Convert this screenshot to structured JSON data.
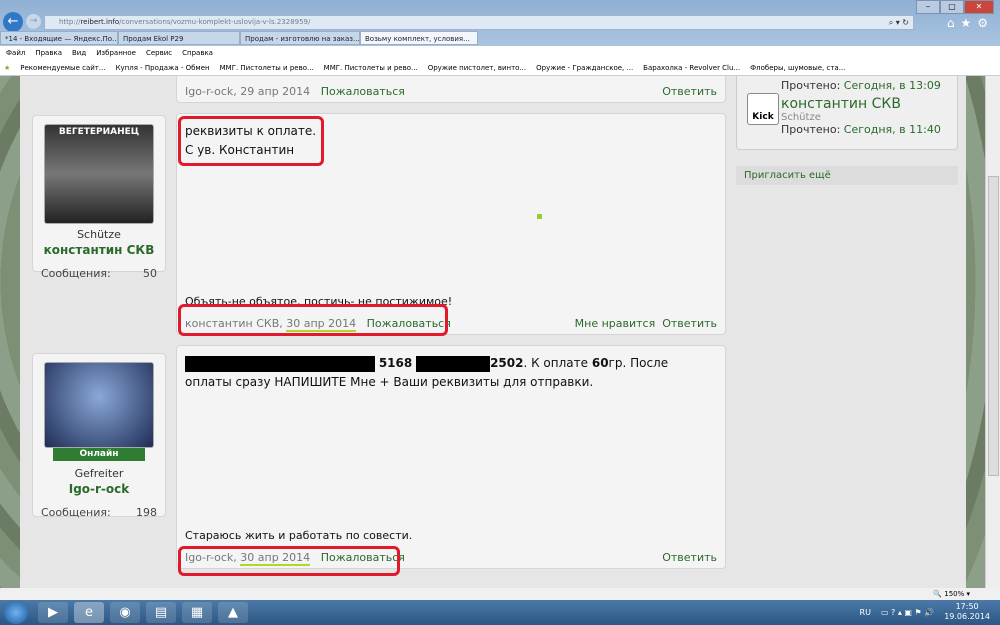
{
  "browser": {
    "url_prefix": "http://",
    "url_host": "reibert.info",
    "url_path": "/conversations/vozmu-komplekt-uslovija-v-ls.2328959/",
    "tabs": [
      {
        "label": "*14 - Входящие — Яндекс.По..."
      },
      {
        "label": "Продам Ekol P29"
      },
      {
        "label": "Продам - изготовлю на заказ..."
      },
      {
        "label": "Возьму комплект, условия..."
      }
    ],
    "menu": [
      "Файл",
      "Правка",
      "Вид",
      "Избранное",
      "Сервис",
      "Справка"
    ],
    "favorites": [
      "Рекомендуемые сайт...",
      "Купля - Продажа - Обмен",
      "ММГ. Пистолеты и рево...",
      "ММГ. Пистолеты и рево...",
      "Оружие пистолет, винто...",
      "Оружие - Гражданское, ...",
      "Барахолка - Revolver Clu...",
      "Флоберы, шумовые, ста..."
    ],
    "zoom": "150%"
  },
  "posts": [
    {
      "author": "Igo-r-ock",
      "date": "29 апр 2014",
      "report": "Пожаловаться",
      "reply": "Ответить"
    },
    {
      "user_title": "Schütze",
      "username": "константин СКВ",
      "stats_label": "Сообщения:",
      "stats_value": "50",
      "avatar_text": "ВЕГЕТЕРИАНЕЦ",
      "lines": [
        "реквизиты к оплате.",
        "С ув. Константин"
      ],
      "signature": "Объять-не объятое, постичь- не постижимое!",
      "author": "константин СКВ",
      "date": "30 апр 2014",
      "report": "Пожаловаться",
      "like": "Мне нравится",
      "reply": "Ответить"
    },
    {
      "online": "Онлайн",
      "user_title": "Gefreiter",
      "username": "Igo-r-ock",
      "stats_label": "Сообщения:",
      "stats_value": "198",
      "card_mid": "5168",
      "card_end": "2502",
      "text_a": ". К оплате ",
      "amount": "60",
      "text_b": "гр. После оплаты сразу НАПИШИТЕ Мне + Ваши реквизиты для отправки.",
      "signature": "Стараюсь жить и работать по совести.",
      "author": "Igo-r-ock",
      "date": "30 апр 2014",
      "report": "Пожаловаться",
      "reply": "Ответить"
    }
  ],
  "sidebar": {
    "read1": "Прочтено:",
    "read1_time": "Сегодня, в 13:09",
    "name": "константин СКВ",
    "title": "Schütze",
    "avatar_text": "Kick",
    "read2": "Прочтено:",
    "read2_time": "Сегодня, в 11:40",
    "invite": "Пригласить ещё"
  },
  "taskbar": {
    "lang": "RU",
    "time": "17:50",
    "date": "19.06.2014"
  }
}
